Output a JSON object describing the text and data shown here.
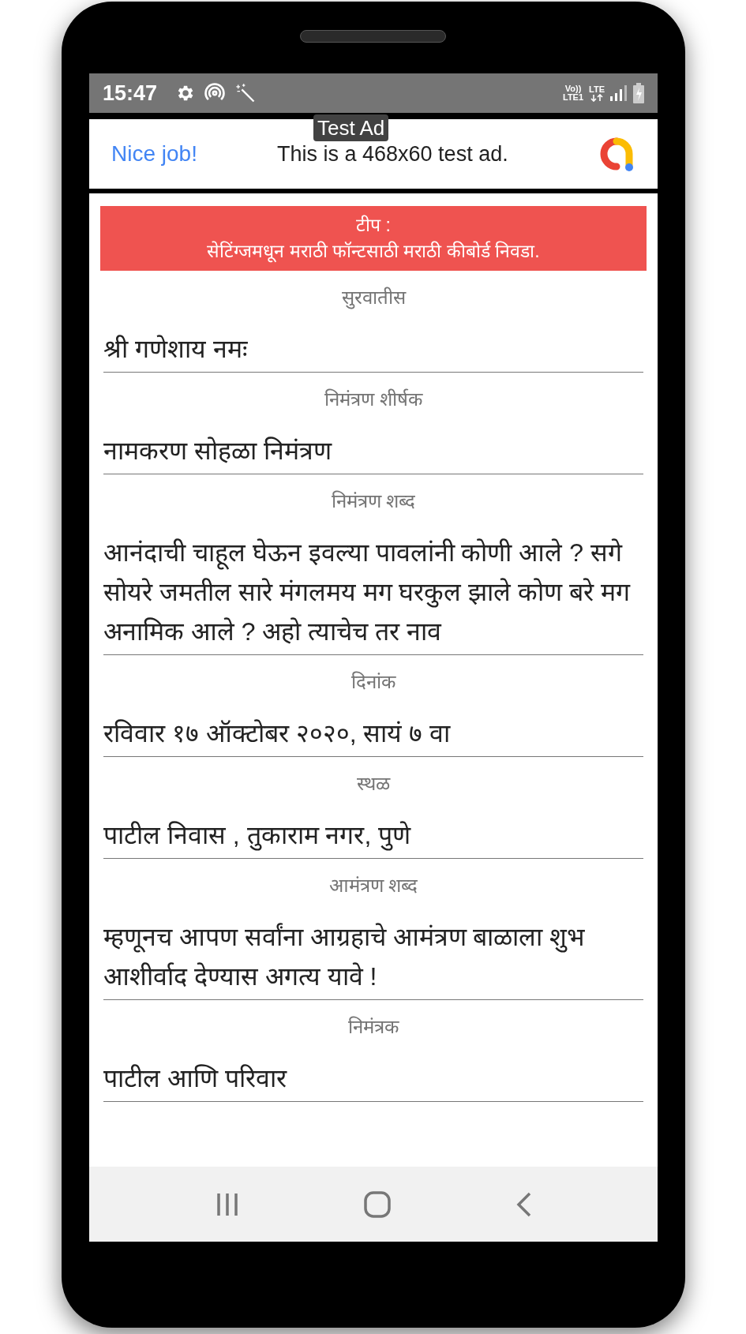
{
  "status_bar": {
    "time": "15:47",
    "network_left": "Vo)) LTE1",
    "network_right": "LTE"
  },
  "ad": {
    "badge": "Test Ad",
    "headline": "Nice job!",
    "text": "This is a 468x60 test ad."
  },
  "tip": {
    "title": "टीप :",
    "text": "सेटिंग्जमधून मराठी फॉन्टसाठी मराठी कीबोर्ड निवडा."
  },
  "fields": [
    {
      "label": "सुरवातीस",
      "value": "श्री गणेशाय नमः"
    },
    {
      "label": "निमंत्रण शीर्षक",
      "value": "नामकरण सोहळा निमंत्रण"
    },
    {
      "label": "निमंत्रण शब्द",
      "value": "आनंदाची चाहूल घेऊन इवल्या पावलांनी कोणी आले ? सगे सोयरे जमतील सारे मंगलमय मग घरकुल झाले कोण बरे मग अनामिक आले ? अहो त्याचेच तर नाव"
    },
    {
      "label": "दिनांक",
      "value": "रविवार १७ ऑक्टोबर २०२०, सायं ७ वा"
    },
    {
      "label": "स्थळ",
      "value": "पाटील निवास , तुकाराम नगर, पुणे"
    },
    {
      "label": "आमंत्रण शब्द",
      "value": "म्हणूनच आपण सर्वांना आग्रहाचे आमंत्रण बाळाला शुभ आशीर्वाद देण्यास अगत्य यावे !"
    },
    {
      "label": "निमंत्रक",
      "value": "पाटील आणि परिवार"
    }
  ]
}
